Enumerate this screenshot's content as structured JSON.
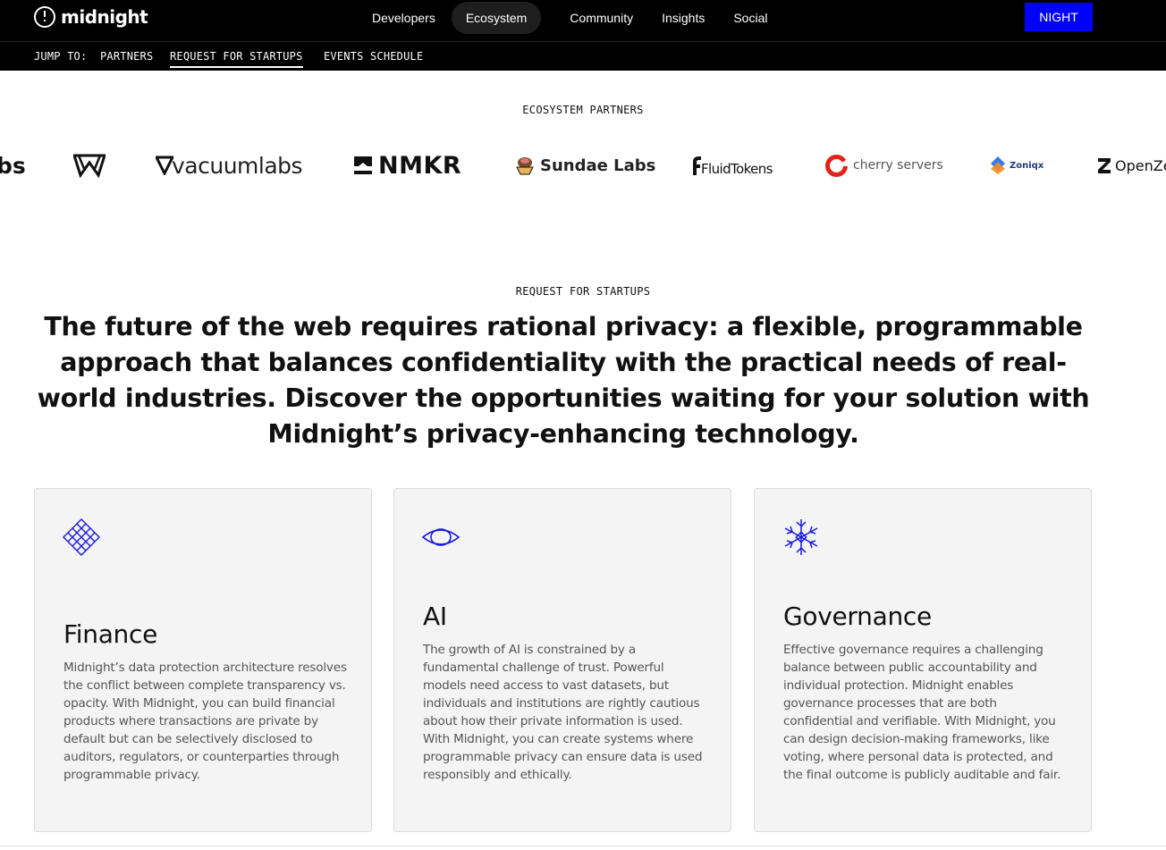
{
  "brand": {
    "name": "midnight",
    "icon": "midnight-logo-icon"
  },
  "nav": {
    "items": [
      {
        "label": "Developers",
        "active": false
      },
      {
        "label": "Ecosystem",
        "active": true
      },
      {
        "label": "Community",
        "active": false
      },
      {
        "label": "Insights",
        "active": false
      },
      {
        "label": "Social",
        "active": false
      }
    ],
    "cta_label": "NIGHT"
  },
  "jump": {
    "label": "JUMP TO:",
    "links": [
      {
        "label": "PARTNERS",
        "active": false
      },
      {
        "label": "REQUEST FOR STARTUPS",
        "active": true
      },
      {
        "label": "EVENTS SCHEDULE",
        "active": false
      }
    ]
  },
  "partners": {
    "eyebrow": "ECOSYSTEM PARTNERS",
    "logos": [
      {
        "name": "bs",
        "icon": "partial-logo"
      },
      {
        "name": "",
        "icon": "w-monogram-icon"
      },
      {
        "name": "vacuumlabs",
        "icon": "vacuumlabs-logo"
      },
      {
        "name": "NMKR",
        "icon": "nmkr-logo-icon"
      },
      {
        "name": "Sundae Labs",
        "icon": "sundae-logo-icon"
      },
      {
        "name": "FluidTokens",
        "icon": "fluidtokens-logo-icon"
      },
      {
        "name": "cherry servers",
        "icon": "cherry-logo-icon"
      },
      {
        "name": "Zoniqx",
        "icon": "zoniqx-logo-icon"
      },
      {
        "name": "OpenZe",
        "icon": "openzeppelin-logo-icon"
      }
    ]
  },
  "startups": {
    "eyebrow": "REQUEST FOR STARTUPS",
    "headline": "The future of the web requires rational privacy: a flexible, programmable approach that balances confidentiality with the practical needs of real-world industries. Discover the opportunities waiting for your solution with Midnight’s privacy-enhancing technology.",
    "cards": [
      {
        "icon": "lattice-diamond-icon",
        "title": "Finance",
        "body": "Midnight’s data protection architecture resolves the conflict between complete transparency vs. opacity. With Midnight, you can build financial products where transactions are private by default but can be selectively disclosed to auditors, regulators, or counterparties through programmable privacy."
      },
      {
        "icon": "eye-icon",
        "title": "AI",
        "body": "The growth of AI is constrained by a fundamental challenge of trust. Powerful models need access to vast datasets, but individuals and institutions are rightly cautious about how their private information is used. With Midnight, you can create systems where programmable privacy can ensure data is used responsibly and ethically."
      },
      {
        "icon": "snowflake-icon",
        "title": "Governance",
        "body": "Effective governance requires a challenging balance between public accountability and individual protection. Midnight enables governance processes that are both confidential and verifiable. With Midnight, you can design decision-making frameworks, like voting, where personal data is protected, and the final outcome is publicly auditable and fair."
      }
    ]
  },
  "colors": {
    "accent": "#0000fe",
    "icon_blue": "#1a1adf",
    "card_bg": "#f4f4f4"
  }
}
